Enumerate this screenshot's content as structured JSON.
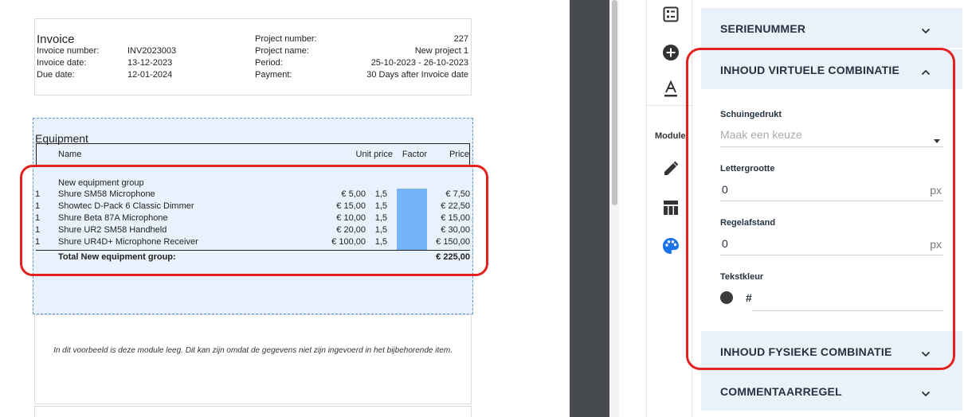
{
  "invoice": {
    "title": "Invoice",
    "left_labels": [
      "Invoice number:",
      "Invoice date:",
      "Due date:"
    ],
    "left_values": [
      "INV2023003",
      "13-12-2023",
      "12-01-2024"
    ],
    "right_labels": [
      "Project number:",
      "Project name:",
      "Period:",
      "Payment:"
    ],
    "right_values": [
      "227",
      "New project 1",
      "25-10-2023 - 26-10-2023",
      "30 Days after Invoice date"
    ]
  },
  "equipment": {
    "title": "Equipment",
    "headers": {
      "name": "Name",
      "unit_price": "Unit price",
      "factor": "Factor",
      "price": "Price"
    },
    "group_name": "New equipment group",
    "items": [
      {
        "qty": "1",
        "name": "Shure SM58 Microphone",
        "unit_price": "€ 5,00",
        "factor": "1,5",
        "price": "€ 7,50"
      },
      {
        "qty": "1",
        "name": "Showtec D-Pack 6 Classic Dimmer",
        "unit_price": "€ 15,00",
        "factor": "1,5",
        "price": "€ 22,50"
      },
      {
        "qty": "1",
        "name": "Shure Beta 87A Microphone",
        "unit_price": "€ 10,00",
        "factor": "1,5",
        "price": "€ 15,00"
      },
      {
        "qty": "1",
        "name": "Shure UR2 SM58 Handheld",
        "unit_price": "€ 20,00",
        "factor": "1,5",
        "price": "€ 30,00"
      },
      {
        "qty": "1",
        "name": "Shure UR4D+ Microphone Receiver",
        "unit_price": "€ 100,00",
        "factor": "1,5",
        "price": "€ 150,00"
      }
    ],
    "total_label": "Total New equipment group:",
    "total_value": "€ 225,00"
  },
  "note": {
    "text": "In dit voorbeeld is deze module leeg. Dit kan zijn omdat de gegevens niet zijn ingevoerd in het bijbehorende item."
  },
  "tools": {
    "label": "Module",
    "icons": [
      "list-icon",
      "add-circle-icon",
      "text-color-icon",
      "pencil-icon",
      "table-icon",
      "palette-icon"
    ]
  },
  "panel": {
    "sections": {
      "serial": "SERIENUMMER",
      "virtual": "INHOUD VIRTUELE COMBINATIE",
      "physical": "INHOUD FYSIEKE COMBINATIE",
      "comment": "COMMENTAARREGEL"
    },
    "fields": {
      "bevel_label": "Schuingedrukt",
      "bevel_placeholder": "Maak een keuze",
      "size_label": "Lettergrootte",
      "size_value": "0",
      "size_unit": "px",
      "spacing_label": "Regelafstand",
      "spacing_value": "0",
      "spacing_unit": "px",
      "color_label": "Tekstkleur",
      "color_hash": "#",
      "color_swatch": "#3a3a3a"
    }
  },
  "colors": {
    "highlight": "#e3221f",
    "equipment_bg": "#e9f2fc",
    "section_bg": "#e9f1fb",
    "gutter": "#474a4e",
    "accent_blue": "#1a73e8"
  }
}
